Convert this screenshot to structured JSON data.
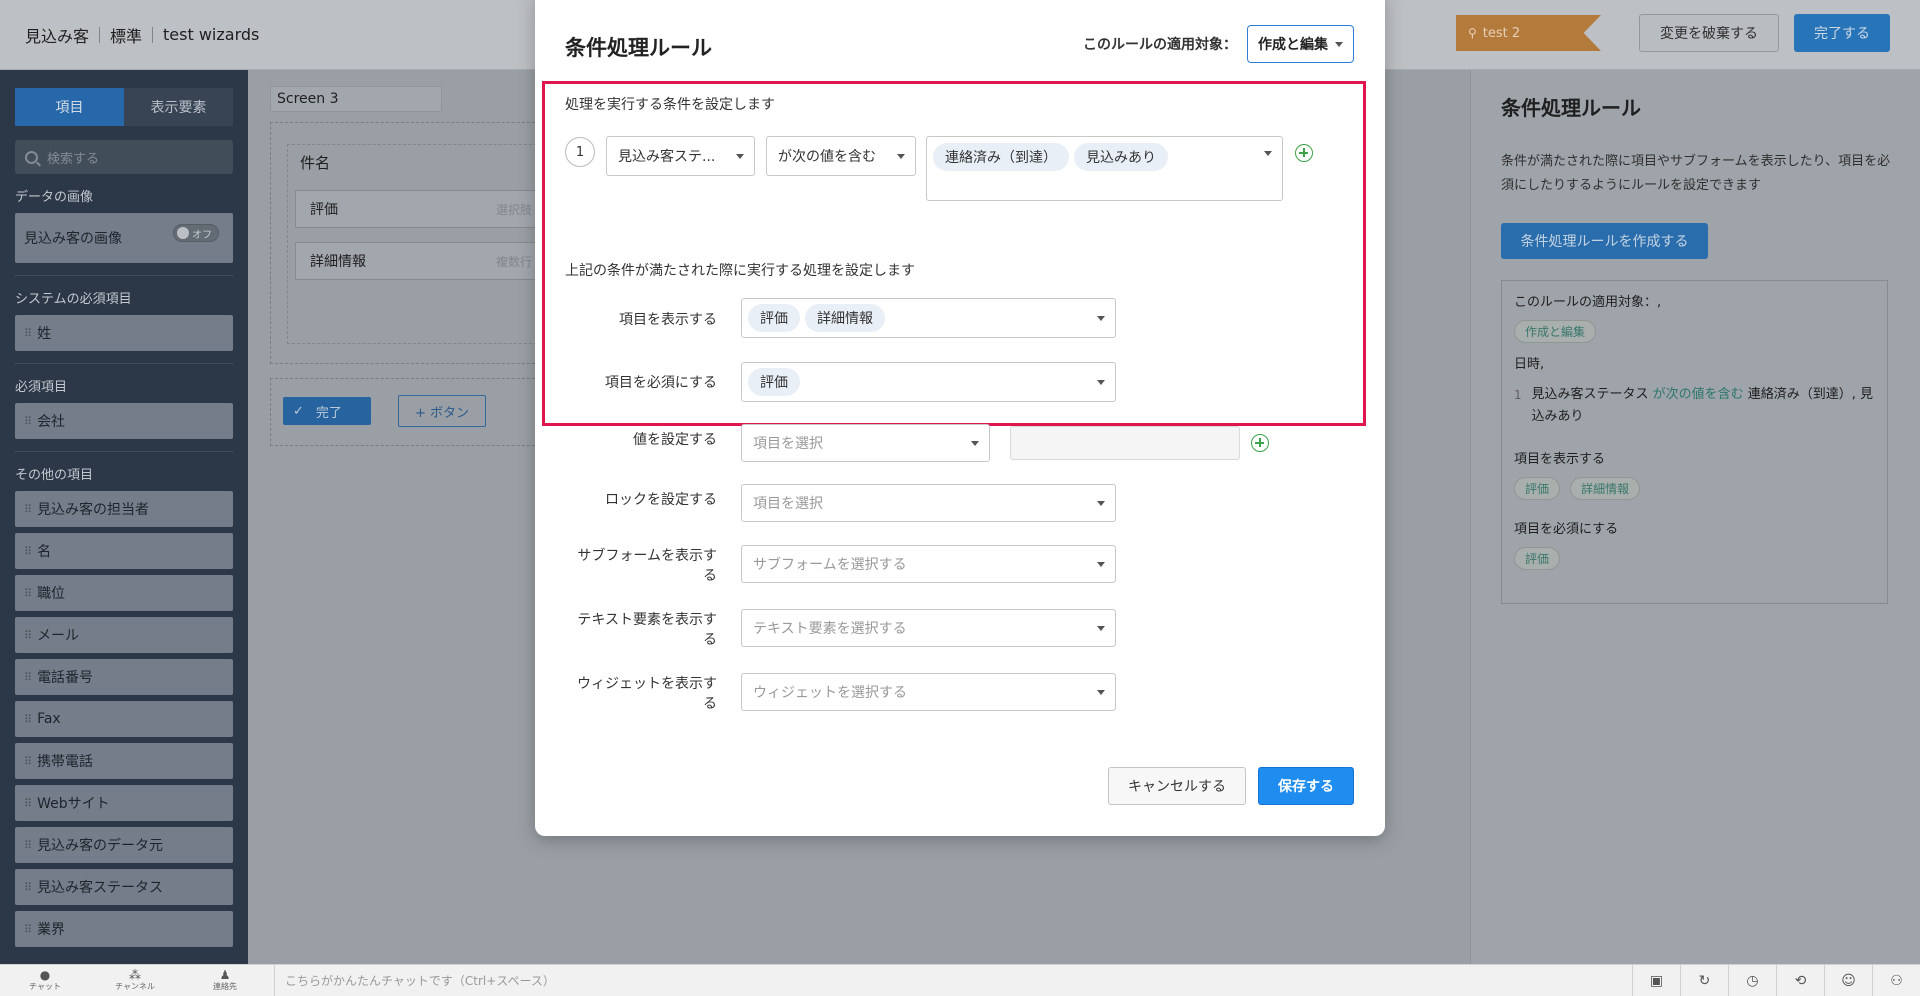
{
  "app": {
    "breadcrumb": [
      "見込み客",
      "標準",
      "test wizards"
    ],
    "test_tag": "test 2",
    "discard_label": "変更を破棄する",
    "complete_label": "完了する"
  },
  "sidebar": {
    "tabs": [
      "項目",
      "表示要素"
    ],
    "search_placeholder": "検索する",
    "sections": {
      "image": "データの画像",
      "system": "システムの必須項目",
      "required": "必須項目",
      "other": "その他の項目"
    },
    "image_item": "見込み客の画像",
    "toggle_label": "オフ",
    "system_items": [
      "姓"
    ],
    "required_items": [
      "会社"
    ],
    "other_items": [
      "見込み客の担当者",
      "名",
      "職位",
      "メール",
      "電話番号",
      "Fax",
      "携帯電話",
      "Webサイト",
      "見込み客のデータ元",
      "見込み客ステータス",
      "業界"
    ]
  },
  "canvas": {
    "screen_name": "Screen 3",
    "form_title": "件名",
    "rows": [
      {
        "label": "評価",
        "ghost": "選択肢"
      },
      {
        "label": "詳細情報",
        "ghost": "複数行"
      }
    ],
    "done_label": "完了",
    "add_button_label": "+ ボタン"
  },
  "right_panel": {
    "title": "条件処理ルール",
    "description": "条件が満たされた際に項目やサブフォームを表示したり、項目を必須にしたりするようにルールを設定できます",
    "create_label": "条件処理ルールを作成する",
    "target_label": "このルールの適用対象：,",
    "target_chip": "作成と編集",
    "datetime_label": "日時,",
    "condition": {
      "num": "1",
      "field": "見込み客ステータス",
      "op": "が次の値を含む",
      "values": "連絡済み（到達）, 見込みあり"
    },
    "show_label": "項目を表示する",
    "show_chips": [
      "評価",
      "詳細情報"
    ],
    "required_label": "項目を必須にする",
    "required_chips": [
      "評価"
    ]
  },
  "modal": {
    "title": "条件処理ルール",
    "target_label": "このルールの適用対象：",
    "target_value": "作成と編集",
    "condition_heading": "処理を実行する条件を設定します",
    "condition": {
      "num": "1",
      "field": "見込み客ステ...",
      "operator": "が次の値を含む",
      "values": [
        "連絡済み（到達）",
        "見込みあり"
      ]
    },
    "action_heading": "上記の条件が満たされた際に実行する処理を設定します",
    "actions": {
      "show_label": "項目を表示する",
      "show_values": [
        "評価",
        "詳細情報"
      ],
      "required_label": "項目を必須にする",
      "required_values": [
        "評価"
      ],
      "set_value_label": "値を設定する",
      "set_value_placeholder": "項目を選択",
      "lock_label": "ロックを設定する",
      "lock_placeholder": "項目を選択",
      "subform_label": "サブフォームを表示する",
      "subform_placeholder": "サブフォームを選択する",
      "text_label": "テキスト要素を表示する",
      "text_placeholder": "テキスト要素を選択する",
      "widget_label": "ウィジェットを表示する",
      "widget_placeholder": "ウィジェットを選択する"
    },
    "cancel_label": "キャンセルする",
    "save_label": "保存する"
  },
  "chatbar": {
    "icons": [
      "チャット",
      "チャンネル",
      "連絡先"
    ],
    "placeholder": "こちらがかんたんチャットです（Ctrl+スペース）"
  },
  "colors": {
    "primary": "#1f8df0",
    "highlight": "#e0164f",
    "add": "#3da34a",
    "sidebar": "#2f3b4c"
  }
}
